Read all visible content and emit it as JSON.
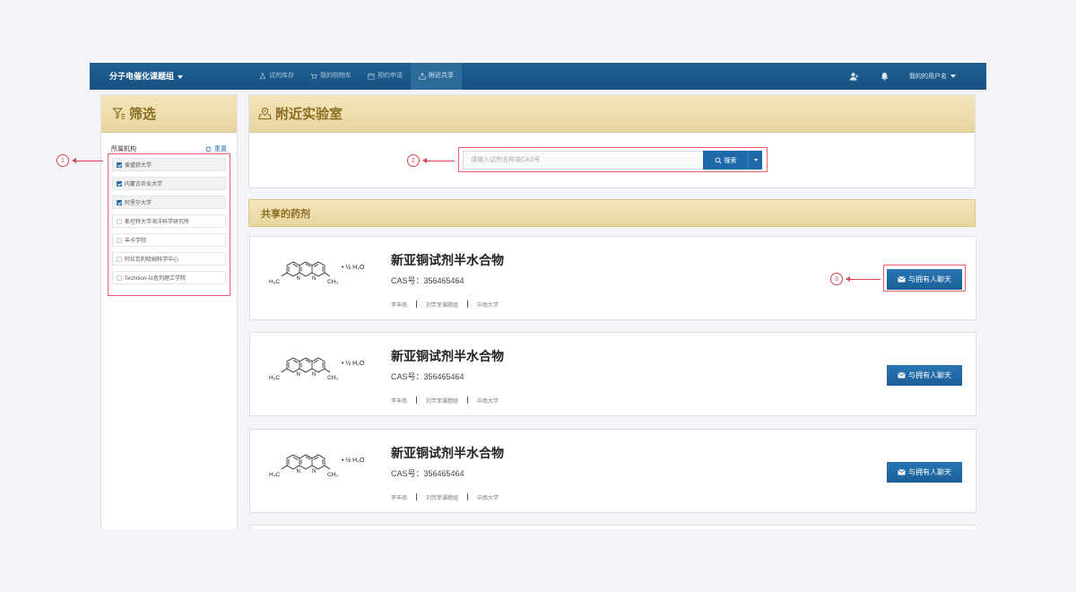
{
  "navbar": {
    "brand": "分子电催化课题组",
    "tabs": [
      {
        "label": "试剂库存",
        "icon": "flask-icon",
        "active": false
      },
      {
        "label": "我的购物车",
        "icon": "cart-icon",
        "active": false
      },
      {
        "label": "预约申请",
        "icon": "calendar-icon",
        "active": false
      },
      {
        "label": "附近共享",
        "icon": "share-icon",
        "active": true
      }
    ],
    "username": "我的的用户名"
  },
  "sidebar": {
    "title": "筛选",
    "filter_label": "所属机构",
    "reset_label": "重置",
    "orgs": [
      {
        "label": "爱盟获大学",
        "checked": true
      },
      {
        "label": "内蒙古农业大学",
        "checked": true
      },
      {
        "label": "阿里尔大学",
        "checked": true
      },
      {
        "label": "斯坦特大学海洋科学研究所",
        "checked": false
      },
      {
        "label": "丰卡学院",
        "checked": false
      },
      {
        "label": "阿拉瓦利哈姆科学中心",
        "checked": false
      },
      {
        "label": "Technion-以色列理工学院",
        "checked": false
      }
    ]
  },
  "lab": {
    "title": "附近实验室",
    "search_placeholder": "请输入试剂名称或CAS号",
    "search_label": "搜索"
  },
  "shared": {
    "title": "共享的药剂",
    "items": [
      {
        "name": "新亚铜试剂半水合物",
        "cas": "CAS号：356465464",
        "person": "李丰南",
        "group": "刘芳菲课题组",
        "org": "中南大学",
        "chat_label": "与拥有人聊天"
      },
      {
        "name": "新亚铜试剂半水合物",
        "cas": "CAS号：356465464",
        "person": "李丰南",
        "group": "刘芳菲课题组",
        "org": "中南大学",
        "chat_label": "与拥有人聊天"
      },
      {
        "name": "新亚铜试剂半水合物",
        "cas": "CAS号：356465464",
        "person": "李丰南",
        "group": "刘芳菲课题组",
        "org": "中南大学",
        "chat_label": "与拥有人聊天"
      }
    ]
  },
  "molecule": {
    "hydrate": "• ½ H₂O",
    "n_label": "N",
    "left_methyl": "H₃C",
    "right_methyl": "CH₃"
  },
  "annotations": [
    "1",
    "2",
    "3"
  ],
  "colors": {
    "navbar": "#1f6193",
    "accent": "#1e6aa8",
    "panel_head": "#e8d59f",
    "annotation": "#d9434f"
  }
}
